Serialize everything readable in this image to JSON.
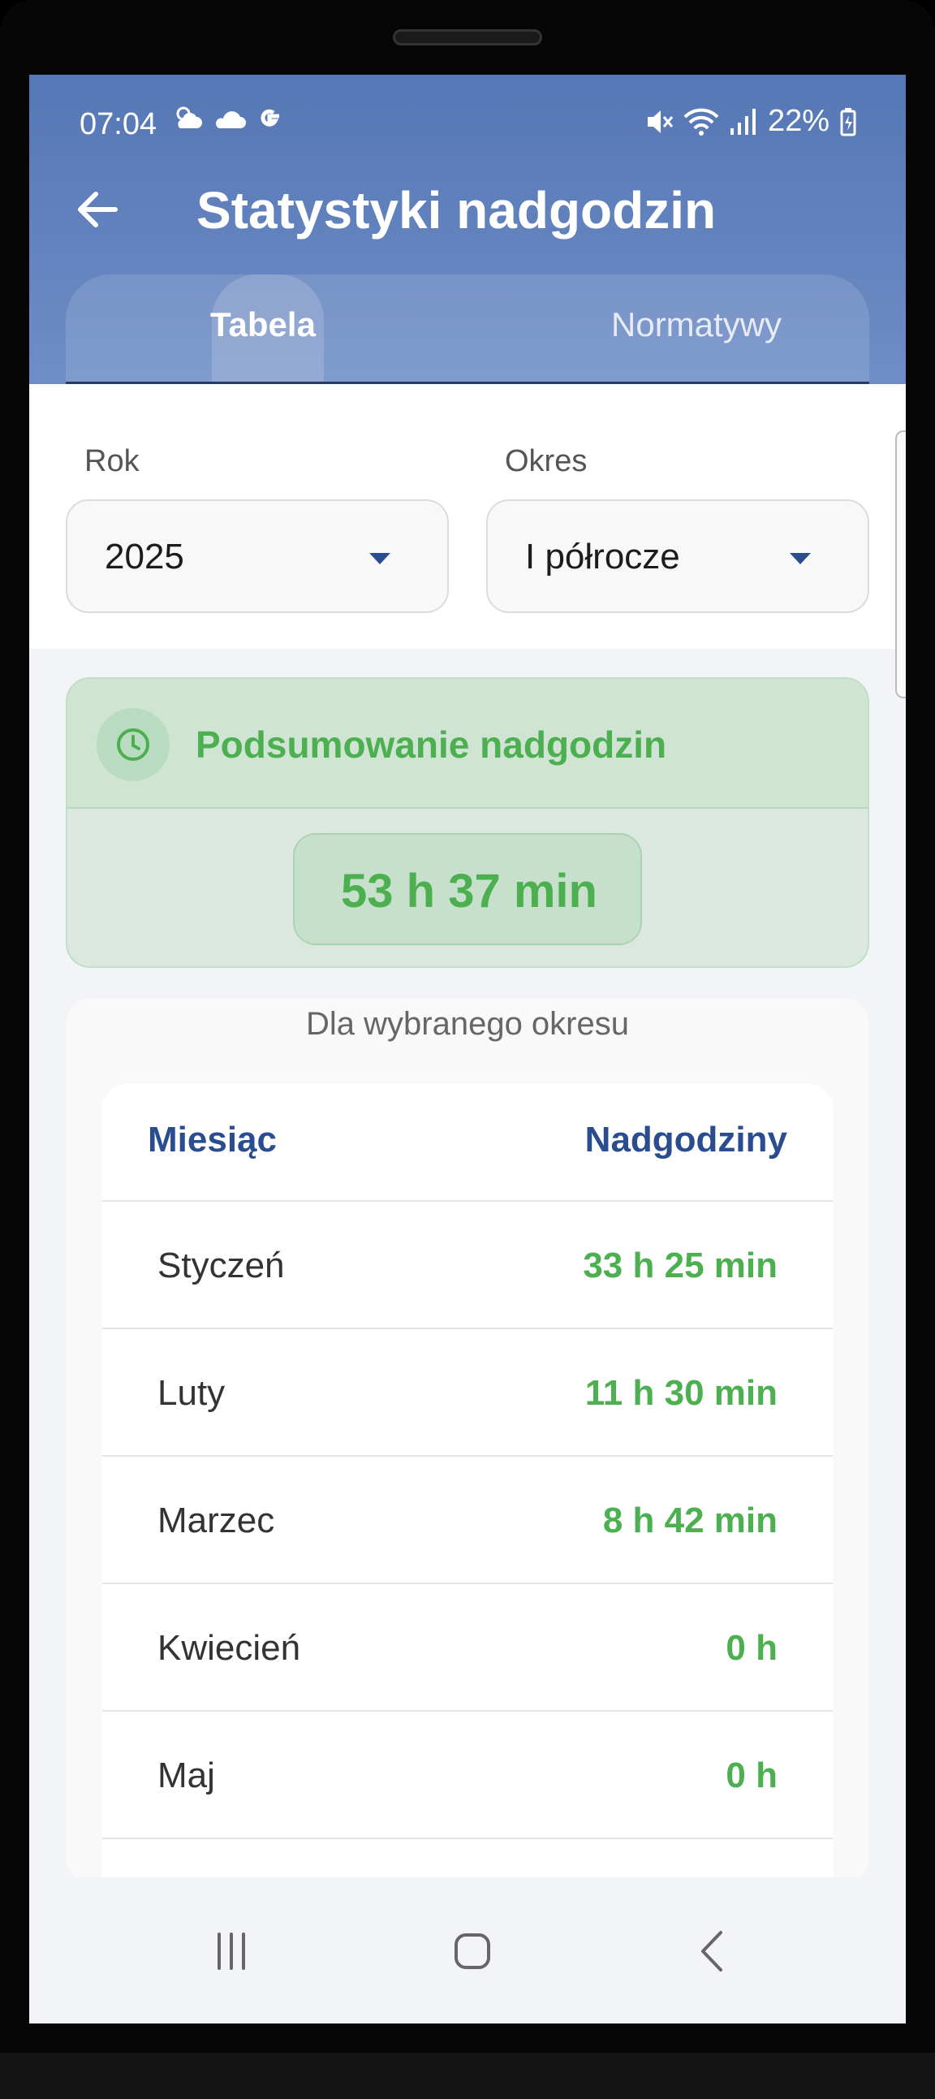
{
  "status_bar": {
    "time": "07:04",
    "battery": "22%",
    "left_icons": [
      "partly-cloudy-icon",
      "cloud-icon",
      "google-icon"
    ],
    "right_icons": [
      "mute-icon",
      "wifi-icon",
      "signal-icon",
      "battery-charging-icon"
    ]
  },
  "header": {
    "title": "Statystyki nadgodzin",
    "back_icon": "arrow-left-icon"
  },
  "tabs": [
    {
      "label": "Tabela",
      "active": true
    },
    {
      "label": "Normatywy",
      "active": false
    }
  ],
  "filters": {
    "year_label": "Rok",
    "year_value": "2025",
    "period_label": "Okres",
    "period_value": "I półrocze"
  },
  "summary": {
    "title": "Podsumowanie nadgodzin",
    "total": "53 h 37 min",
    "icon": "clock-icon"
  },
  "table": {
    "caption": "Dla wybranego okresu",
    "col_month": "Miesiąc",
    "col_overtime": "Nadgodziny",
    "rows": [
      {
        "month": "Styczeń",
        "overtime": "33 h 25 min"
      },
      {
        "month": "Luty",
        "overtime": "11 h 30 min"
      },
      {
        "month": "Marzec",
        "overtime": "8 h 42 min"
      },
      {
        "month": "Kwiecień",
        "overtime": "0 h"
      },
      {
        "month": "Maj",
        "overtime": "0 h"
      }
    ]
  },
  "colors": {
    "header_blue": "#5577b5",
    "accent_blue": "#2a4d90",
    "accent_green": "#4caf50"
  },
  "nav_bar": [
    "recent-apps-icon",
    "home-icon",
    "back-icon"
  ]
}
